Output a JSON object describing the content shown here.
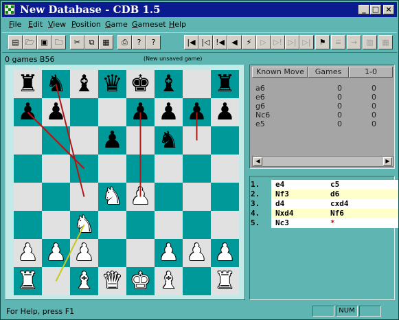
{
  "window": {
    "title": "New Database - CDB 1.5",
    "minimize": "_",
    "maximize": "□",
    "close": "×"
  },
  "menu": [
    "File",
    "Edit",
    "View",
    "Position",
    "Game",
    "Gameset",
    "Help"
  ],
  "menu_accel": [
    "F",
    "E",
    "V",
    "P",
    "G",
    "G",
    "H"
  ],
  "toolbar": {
    "left": [
      {
        "name": "new-db-icon",
        "glyph": "▤",
        "enabled": true
      },
      {
        "name": "open-folder-icon",
        "glyph": "🗁",
        "enabled": true
      },
      {
        "name": "save-icon",
        "glyph": "▣",
        "enabled": true
      },
      {
        "name": "open-game-icon",
        "glyph": "🗀",
        "enabled": true
      },
      {
        "name": "cut-icon",
        "glyph": "✂",
        "enabled": true
      },
      {
        "name": "copy-icon",
        "glyph": "⧉",
        "enabled": true
      },
      {
        "name": "paste-icon",
        "glyph": "▦",
        "enabled": true
      },
      {
        "name": "print-icon",
        "glyph": "⎙",
        "enabled": true
      },
      {
        "name": "help-icon",
        "glyph": "?",
        "enabled": true
      },
      {
        "name": "context-help-icon",
        "glyph": "?",
        "enabled": true
      }
    ],
    "nav": [
      {
        "name": "first-move-icon",
        "glyph": "|◀",
        "enabled": true
      },
      {
        "name": "back-variation-icon",
        "glyph": "|◁",
        "enabled": true
      },
      {
        "name": "back-annotated-icon",
        "glyph": "!◀",
        "enabled": true
      },
      {
        "name": "back-move-icon",
        "glyph": "◀",
        "enabled": true
      },
      {
        "name": "analyze-icon",
        "glyph": "⚡",
        "enabled": true
      },
      {
        "name": "forward-move-icon",
        "glyph": "▷",
        "enabled": false
      },
      {
        "name": "forward-annotated-icon",
        "glyph": "▷!",
        "enabled": false
      },
      {
        "name": "forward-variation-icon",
        "glyph": "▷|",
        "enabled": false
      },
      {
        "name": "last-move-icon",
        "glyph": "▷|",
        "enabled": false
      }
    ],
    "right": [
      {
        "name": "flag-icon",
        "glyph": "⚑",
        "enabled": true
      },
      {
        "name": "tree-icon",
        "glyph": "≡",
        "enabled": false
      },
      {
        "name": "arrow-icon",
        "glyph": "→",
        "enabled": false
      },
      {
        "name": "graph-icon",
        "glyph": "▥",
        "enabled": false
      },
      {
        "name": "stats-icon",
        "glyph": "▦",
        "enabled": false
      }
    ]
  },
  "info": {
    "games": "0 games B56",
    "unsaved": "(New unsaved game)"
  },
  "board": [
    [
      "r",
      "n",
      "b",
      "q",
      "k",
      "b",
      "",
      "r"
    ],
    [
      "p",
      "p",
      "",
      "",
      "p",
      "p",
      "p",
      "p"
    ],
    [
      "",
      "",
      "",
      "p",
      "",
      "n",
      "",
      ""
    ],
    [
      "",
      "",
      "",
      "",
      "",
      "",
      "",
      ""
    ],
    [
      "",
      "",
      "",
      "N",
      "P",
      "",
      "",
      ""
    ],
    [
      "",
      "",
      "N",
      "",
      "",
      "",
      "",
      ""
    ],
    [
      "P",
      "P",
      "P",
      "",
      "",
      "P",
      "P",
      "P"
    ],
    [
      "R",
      "",
      "B",
      "Q",
      "K",
      "B",
      "",
      "R"
    ]
  ],
  "arrows": [
    {
      "from": [
        1,
        0
      ],
      "to": [
        2,
        4
      ],
      "color": "#b01616"
    },
    {
      "from": [
        0,
        1
      ],
      "to": [
        2,
        3
      ],
      "color": "#b01616"
    },
    {
      "from": [
        4,
        1
      ],
      "to": [
        4,
        4
      ],
      "color": "#b01616"
    },
    {
      "from": [
        6,
        1
      ],
      "to": [
        6,
        2
      ],
      "color": "#b01616"
    },
    {
      "from": [
        2,
        5
      ],
      "to": [
        1,
        7
      ],
      "color": "#c8c81e"
    }
  ],
  "moves_table": {
    "headers": [
      "Known Move",
      "Games",
      "1-0"
    ],
    "rows": [
      {
        "move": "a6",
        "games": "0",
        "win": "0"
      },
      {
        "move": "e6",
        "games": "0",
        "win": "0"
      },
      {
        "move": "g6",
        "games": "0",
        "win": "0"
      },
      {
        "move": "Nc6",
        "games": "0",
        "win": "0"
      },
      {
        "move": "e5",
        "games": "0",
        "win": "0"
      }
    ]
  },
  "notation": [
    {
      "num": "1.",
      "white": "e4",
      "black": "c5",
      "bg": "#ffffff"
    },
    {
      "num": "2.",
      "white": "Nf3",
      "black": "d6",
      "bg": "#ffffcc"
    },
    {
      "num": "3.",
      "white": "d4",
      "black": "cxd4",
      "bg": "#ffffff"
    },
    {
      "num": "4.",
      "white": "Nxd4",
      "black": "Nf6",
      "bg": "#ffffcc"
    },
    {
      "num": "5.",
      "white": "Nc3",
      "black": "*",
      "bg": "#ffffff"
    }
  ],
  "status": {
    "help": "For Help, press F1",
    "num": "NUM"
  },
  "colors": {
    "dark_square": "#009999",
    "light_square": "#e1e1e1",
    "titlebar": "#0b1a8f"
  }
}
